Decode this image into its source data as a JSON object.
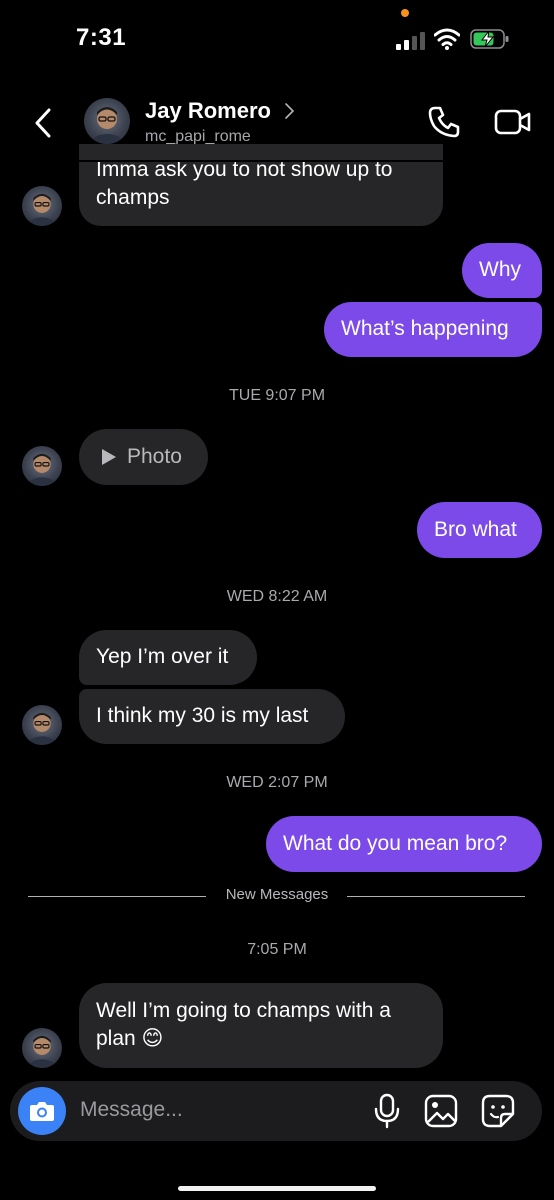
{
  "status_bar": {
    "time": "7:31"
  },
  "header": {
    "contact_name": "Jay Romero",
    "username": "mc_papi_rome"
  },
  "messages": [
    {
      "direction": "incoming",
      "text_line1": "Imma ask you to not show up to",
      "text_line2": "champs"
    },
    {
      "direction": "outgoing",
      "text": "Why"
    },
    {
      "direction": "outgoing",
      "text": "What’s happening"
    },
    {
      "direction": "incoming",
      "type": "photo",
      "text": "Photo"
    },
    {
      "direction": "outgoing",
      "text": "Bro what"
    },
    {
      "direction": "incoming",
      "text": "Yep I’m over it"
    },
    {
      "direction": "incoming",
      "text": "I think my 30 is my last"
    },
    {
      "direction": "outgoing",
      "text": "What do you mean bro?"
    },
    {
      "direction": "incoming",
      "text_line1": "Well I’m going to champs with a",
      "text_line2": "plan 😊"
    }
  ],
  "timestamps": [
    "TUE 9:07 PM",
    "WED 8:22 AM",
    "WED 2:07 PM",
    "7:05 PM"
  ],
  "divider": {
    "label": "New Messages"
  },
  "composer": {
    "placeholder": "Message..."
  },
  "colors": {
    "outgoing_bubble": "#7b4ae8",
    "incoming_bubble": "#262628",
    "camera_button": "#3b82f6",
    "status_dot": "#f7921e",
    "battery_charging": "#34c759"
  },
  "icons": [
    "back-arrow-icon",
    "chevron-right-icon",
    "phone-icon",
    "video-camera-icon",
    "play-icon",
    "camera-icon",
    "microphone-icon",
    "gallery-icon",
    "sticker-icon",
    "signal-icon",
    "wifi-icon",
    "battery-charging-icon"
  ]
}
